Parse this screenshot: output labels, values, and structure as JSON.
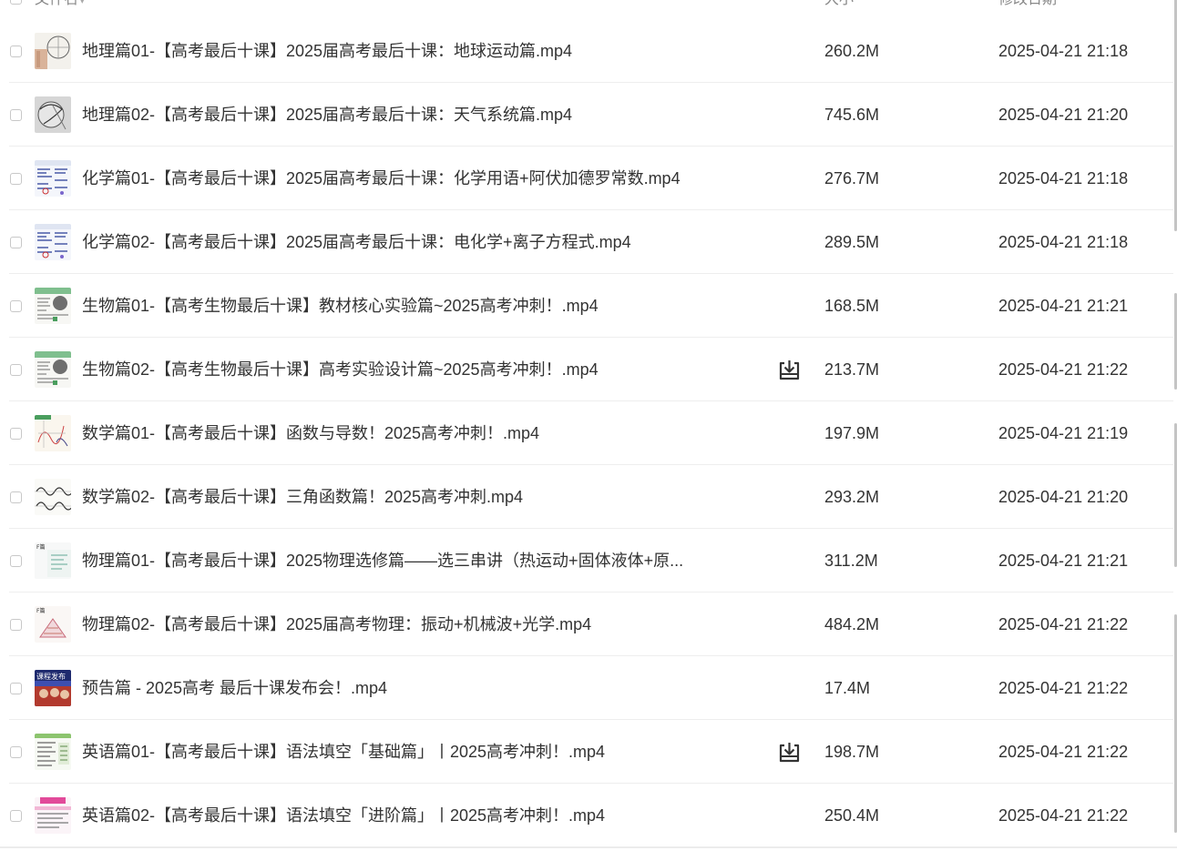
{
  "header": {
    "name_label": "文件名",
    "size_label": "大小",
    "date_label": "修改日期"
  },
  "files": [
    {
      "name": "地理篇01-【高考最后十课】2025届高考最后十课：地球运动篇.mp4",
      "size": "260.2M",
      "date": "2025-04-21 21:18",
      "thumb": "geo1"
    },
    {
      "name": "地理篇02-【高考最后十课】2025届高考最后十课：天气系统篇.mp4",
      "size": "745.6M",
      "date": "2025-04-21 21:20",
      "thumb": "geo2"
    },
    {
      "name": "化学篇01-【高考最后十课】2025届高考最后十课：化学用语+阿伏加德罗常数.mp4",
      "size": "276.7M",
      "date": "2025-04-21 21:18",
      "thumb": "chem"
    },
    {
      "name": "化学篇02-【高考最后十课】2025届高考最后十课：电化学+离子方程式.mp4",
      "size": "289.5M",
      "date": "2025-04-21 21:18",
      "thumb": "chem"
    },
    {
      "name": "生物篇01-【高考生物最后十课】教材核心实验篇~2025高考冲刺！.mp4",
      "size": "168.5M",
      "date": "2025-04-21 21:21",
      "thumb": "bio"
    },
    {
      "name": "生物篇02-【高考生物最后十课】高考实验设计篇~2025高考冲刺！.mp4",
      "size": "213.7M",
      "date": "2025-04-21 21:22",
      "thumb": "bio",
      "download": true
    },
    {
      "name": "数学篇01-【高考最后十课】函数与导数！2025高考冲刺！.mp4",
      "size": "197.9M",
      "date": "2025-04-21 21:19",
      "thumb": "math1"
    },
    {
      "name": "数学篇02-【高考最后十课】三角函数篇！2025高考冲刺.mp4",
      "size": "293.2M",
      "date": "2025-04-21 21:20",
      "thumb": "math2"
    },
    {
      "name": "物理篇01-【高考最后十课】2025物理选修篇——选三串讲（热运动+固体液体+原...",
      "size": "311.2M",
      "date": "2025-04-21 21:21",
      "thumb": "phys1"
    },
    {
      "name": "物理篇02-【高考最后十课】2025届高考物理：振动+机械波+光学.mp4",
      "size": "484.2M",
      "date": "2025-04-21 21:22",
      "thumb": "phys2"
    },
    {
      "name": "预告篇 - 2025高考 最后十课发布会！.mp4",
      "size": "17.4M",
      "date": "2025-04-21 21:22",
      "thumb": "promo"
    },
    {
      "name": "英语篇01-【高考最后十课】语法填空「基础篇」丨2025高考冲刺！.mp4",
      "size": "198.7M",
      "date": "2025-04-21 21:22",
      "thumb": "eng1",
      "download": true
    },
    {
      "name": "英语篇02-【高考最后十课】语法填空「进阶篇」丨2025高考冲刺！.mp4",
      "size": "250.4M",
      "date": "2025-04-21 21:22",
      "thumb": "eng2"
    }
  ],
  "icons": {
    "download": "download-icon",
    "checkbox": "checkbox-icon"
  },
  "colors": {
    "text": "#333333",
    "header_text": "#888888",
    "divider": "#eeeeee",
    "checkbox_border": "#c8c8c8"
  }
}
